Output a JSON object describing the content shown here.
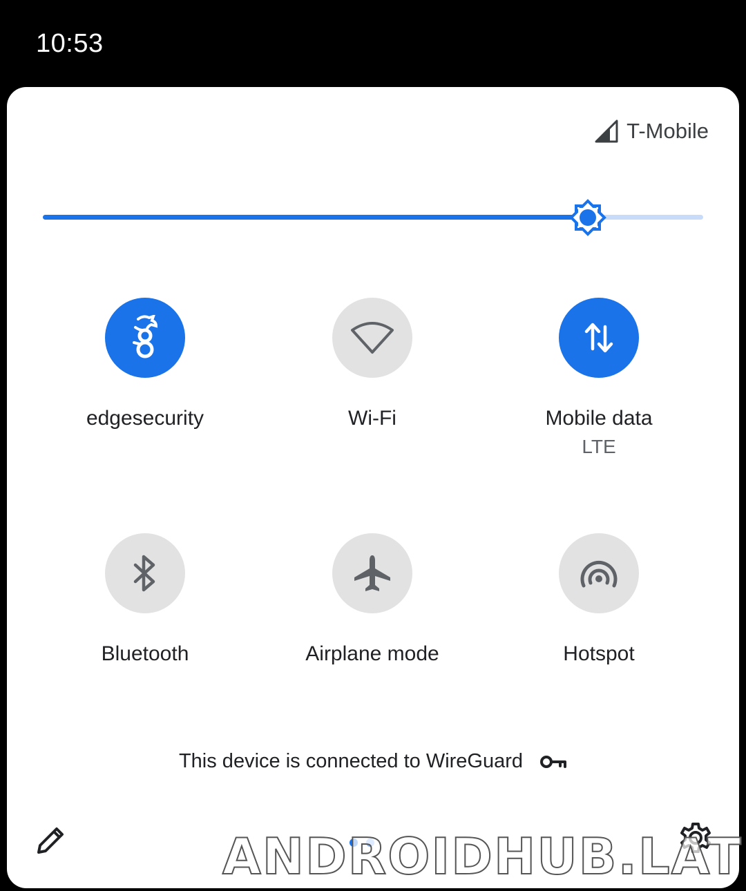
{
  "status_bar": {
    "time": "10:53"
  },
  "panel": {
    "carrier": {
      "name": "T-Mobile",
      "icon": "signal-icon"
    },
    "brightness": {
      "level_percent": 82.5,
      "icon": "brightness-icon"
    },
    "tiles": [
      {
        "label": "edgesecurity",
        "sublabel": "",
        "state": "on",
        "icon": "wireguard-icon"
      },
      {
        "label": "Wi-Fi",
        "sublabel": "",
        "state": "off",
        "icon": "wifi-icon"
      },
      {
        "label": "Mobile data",
        "sublabel": "LTE",
        "state": "on",
        "icon": "mobile-data-icon"
      },
      {
        "label": "Bluetooth",
        "sublabel": "",
        "state": "off",
        "icon": "bluetooth-icon"
      },
      {
        "label": "Airplane mode",
        "sublabel": "",
        "state": "off",
        "icon": "airplane-icon"
      },
      {
        "label": "Hotspot",
        "sublabel": "",
        "state": "off",
        "icon": "hotspot-icon"
      }
    ],
    "vpn_notice": {
      "text": "This device is connected to WireGuard",
      "icon": "key-icon"
    },
    "footer": {
      "edit_icon": "pencil-icon",
      "settings_icon": "gear-icon",
      "pages": 2,
      "active_page": 1
    }
  },
  "watermark": {
    "text": "ANDROIDHUB.LAT"
  },
  "colors": {
    "accent": "#1a73e8",
    "accent_light": "#c8dcf9",
    "tile_off": "#e2e2e2",
    "icon_off": "#5f6368",
    "text_primary": "#202124"
  }
}
